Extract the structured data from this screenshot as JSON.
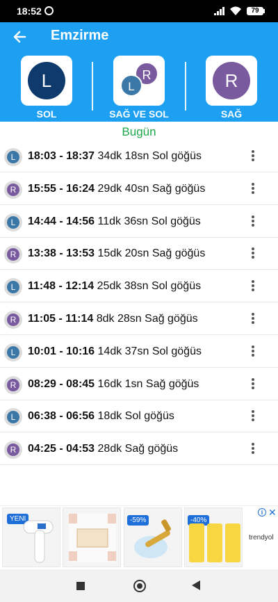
{
  "status_bar": {
    "time": "18:52",
    "battery": "79"
  },
  "app_bar": {
    "title": "Emzirme"
  },
  "selector": {
    "left": {
      "label": "SOL",
      "letter": "L"
    },
    "both": {
      "label": "SAĞ VE SOL",
      "letter_left": "L",
      "letter_right": "R"
    },
    "right": {
      "label": "SAĞ",
      "letter": "R"
    }
  },
  "colors": {
    "left_avatar": "#0e3a6e",
    "right_avatar": "#7a5a9e",
    "accent": "#1ea0f2",
    "section": "#1fa84a"
  },
  "section_title": "Bugün",
  "sessions": [
    {
      "side": "L",
      "range": "18:03 - 18:37",
      "duration": "34dk 18sn",
      "breast": "Sol göğüs"
    },
    {
      "side": "R",
      "range": "15:55 - 16:24",
      "duration": "29dk 40sn",
      "breast": "Sağ göğüs"
    },
    {
      "side": "L",
      "range": "14:44 - 14:56",
      "duration": "11dk 36sn",
      "breast": "Sol göğüs"
    },
    {
      "side": "R",
      "range": "13:38 - 13:53",
      "duration": "15dk 20sn",
      "breast": "Sağ göğüs"
    },
    {
      "side": "L",
      "range": "11:48 - 12:14",
      "duration": "25dk 38sn",
      "breast": "Sol göğüs"
    },
    {
      "side": "R",
      "range": "11:05 - 11:14",
      "duration": "8dk 28sn",
      "breast": "Sağ göğüs"
    },
    {
      "side": "L",
      "range": "10:01 - 10:16",
      "duration": "14dk 37sn",
      "breast": "Sol göğüs"
    },
    {
      "side": "R",
      "range": "08:29 - 08:45",
      "duration": "16dk 1sn",
      "breast": "Sağ göğüs"
    },
    {
      "side": "L",
      "range": "06:38 - 06:56",
      "duration": "18dk",
      "breast": "Sol göğüs"
    },
    {
      "side": "R",
      "range": "04:25 - 04:53",
      "duration": "28dk",
      "breast": "Sağ göğüs"
    }
  ],
  "ad": {
    "badge_new": "YENI",
    "discount_1": "-59%",
    "discount_2": "-40%",
    "brand": "trendyol"
  }
}
